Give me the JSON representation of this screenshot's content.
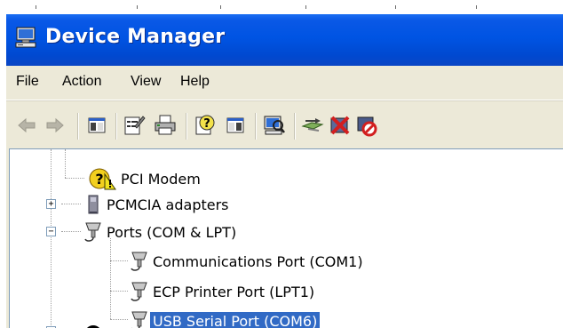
{
  "window": {
    "title": "Device Manager",
    "title_icon": "computer-icon"
  },
  "menu": {
    "items": [
      "File",
      "Action",
      "View",
      "Help"
    ]
  },
  "toolbar": {
    "buttons": [
      {
        "name": "back-button",
        "icon": "arrow-left-icon"
      },
      {
        "name": "forward-button",
        "icon": "arrow-right-icon"
      },
      {
        "name": "show-hide-console-tree-button",
        "icon": "console-tree-icon"
      },
      {
        "name": "properties-button",
        "icon": "properties-icon"
      },
      {
        "name": "print-button",
        "icon": "printer-icon"
      },
      {
        "name": "help-button",
        "icon": "help-icon"
      },
      {
        "name": "show-hide-action-pane-button",
        "icon": "action-pane-icon"
      },
      {
        "name": "scan-hardware-button",
        "icon": "scan-hardware-icon"
      },
      {
        "name": "update-driver-button",
        "icon": "update-driver-icon"
      },
      {
        "name": "uninstall-button",
        "icon": "uninstall-icon"
      },
      {
        "name": "disable-button",
        "icon": "disable-icon"
      }
    ]
  },
  "tree": {
    "items": [
      {
        "label": "PCI Modem",
        "icon": "warning-modem-icon"
      },
      {
        "label": "PCMCIA adapters",
        "icon": "pcmcia-icon",
        "expander": "+"
      },
      {
        "label": "Ports (COM & LPT)",
        "icon": "port-icon",
        "expander": "−"
      },
      {
        "label": "Communications Port (COM1)",
        "icon": "port-icon"
      },
      {
        "label": "ECP Printer Port (LPT1)",
        "icon": "port-icon"
      },
      {
        "label": "USB Serial Port (COM6)",
        "icon": "port-icon",
        "selected": true
      }
    ]
  },
  "colors": {
    "titlebar": "#0054e3",
    "selection": "#316ac5",
    "chrome": "#ece9d8"
  }
}
